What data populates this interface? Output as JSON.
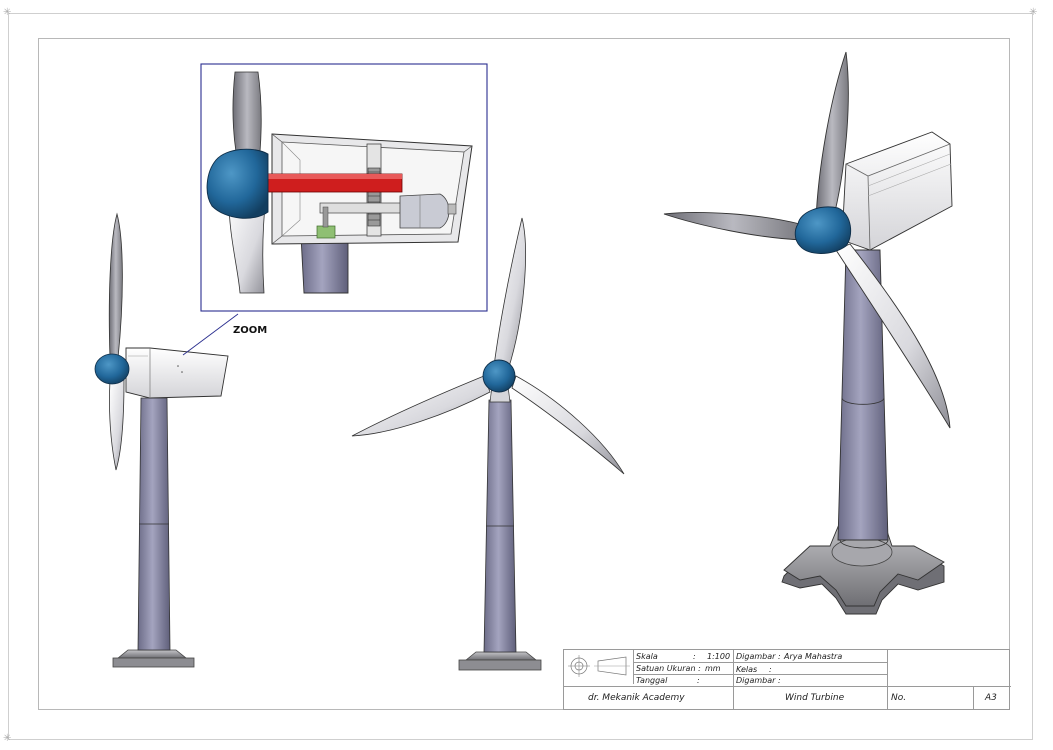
{
  "drawing": {
    "title": "Wind Turbine",
    "zoom_label": "ZOOM",
    "colors": {
      "blade": "#e9e9ee",
      "hub": "#2a6f9e",
      "tower": "#8a8aa6",
      "nacelle": "#f1f1f1",
      "shaft": "#cf1e1e",
      "base": "#9a9a9a",
      "frame": "#2b2f8f"
    }
  },
  "title_block": {
    "scale_label": "Skala",
    "scale_value": "1:100",
    "units_label": "Satuan Ukuran :",
    "units_value": "mm",
    "date_label": "Tanggal",
    "date_sep": ":",
    "scale_sep": ":",
    "drawn_by_label": "Digambar :",
    "drawn_by_value": "Arya Mahastra",
    "class_label": "Kelas",
    "class_sep": ":",
    "checked_label": "Digambar :",
    "company": "dr. Mekanik Academy",
    "drawing_title": "Wind Turbine",
    "number_label": "No.",
    "size": "A3"
  }
}
